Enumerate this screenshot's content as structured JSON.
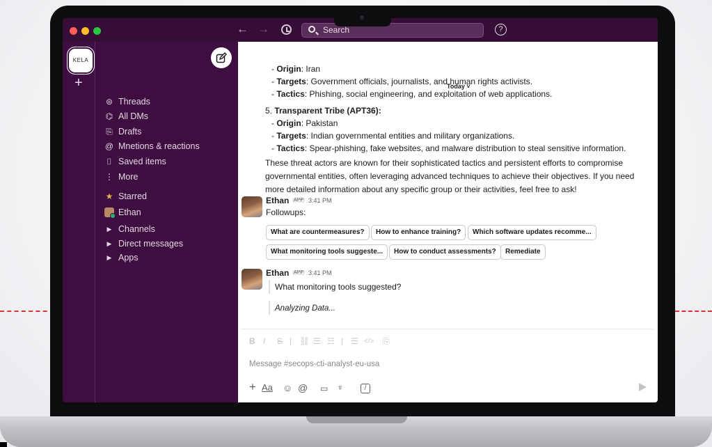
{
  "window": {
    "traffic_lights": [
      "#ff5f57",
      "#febc2e",
      "#28c840"
    ],
    "search_placeholder": "Search",
    "help_label": "?"
  },
  "workspace": {
    "logo_text": "KELA",
    "add_label": "+"
  },
  "sidebar": {
    "items": [
      {
        "icon": "threads-icon",
        "glyph": "⊜",
        "label": "Threads"
      },
      {
        "icon": "dms-icon",
        "glyph": "⌬",
        "label": "All DMs"
      },
      {
        "icon": "drafts-icon",
        "glyph": "⎘",
        "label": "Drafts"
      },
      {
        "icon": "mention-icon",
        "glyph": "@",
        "label": "Mnetions & reactions"
      },
      {
        "icon": "bookmark-icon",
        "glyph": "⌷",
        "label": "Saved items"
      },
      {
        "icon": "more-icon",
        "glyph": "⋮",
        "label": "More"
      }
    ],
    "starred_label": "Starred",
    "starred_user": "Ethan",
    "sections": [
      "Channels",
      "Direct messages",
      "Apps"
    ]
  },
  "messages": {
    "today_label": "Today ˅",
    "iran_block": {
      "origin_key": "Origin",
      "origin_val": ": Iran",
      "targets_key": "Targets",
      "targets_val": ": Government officials, journalists, and human rights activists.",
      "tactics_key": "Tactics",
      "tactics_val": ": Phishing, social engineering, and exploitation of web applications."
    },
    "apt36_block": {
      "heading_prefix": "5. ",
      "heading": "Transparent Tribe (APT36)",
      "heading_suffix": ":",
      "origin_key": "Origin",
      "origin_val": ": Pakistan",
      "targets_key": "Targets",
      "targets_val": ": Indian governmental entities and military organizations.",
      "tactics_key": "Tactics",
      "tactics_val": ": Spear-phishing, fake websites, and malware distribution to steal sensitive information."
    },
    "summary": "These threat actors are known for their sophisticated tactics and persistent efforts to compromise governmental entities, often leveraging advanced techniques to achieve their objectives. If you need more detailed information about any specific group or their activities, feel free to ask!",
    "followup_msg": {
      "author": "Ethan",
      "badge": "APP",
      "time": "3:41 PM",
      "text": "Followups:",
      "chips_row1": [
        "What are countermeasures?",
        "How to enhance training?",
        "Which software updates recomme..."
      ],
      "chips_row2": [
        "What monitoring tools suggeste...",
        "How to conduct assessments?",
        "Remediate"
      ]
    },
    "reply_msg": {
      "author": "Ethan",
      "badge": "APP",
      "time": "3:41 PM",
      "quote": "What monitoring tools suggested?",
      "status": "Analyzing Data..."
    }
  },
  "composer": {
    "placeholder": "Message #secops-cti-analyst-eu-usa",
    "format_glyphs": [
      "B",
      "I",
      "S",
      "|",
      "⛓",
      "☰",
      "☷",
      "|",
      "☰",
      "</>",
      "⎘"
    ]
  }
}
